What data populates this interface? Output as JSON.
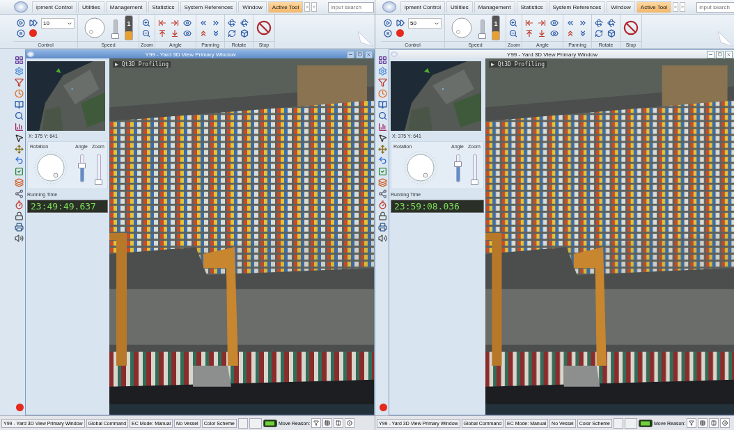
{
  "screens": [
    {
      "menu_tabs": [
        {
          "label": "ipment Control",
          "selected": false
        },
        {
          "label": "Utilities",
          "selected": false
        },
        {
          "label": "Management",
          "selected": false
        },
        {
          "label": "Statistics",
          "selected": false
        },
        {
          "label": "System References",
          "selected": false
        },
        {
          "label": "Window",
          "selected": false
        },
        {
          "label": "Active Tool",
          "selected": true
        }
      ],
      "search": {
        "placeholder": "input search"
      },
      "ribbon_groups": [
        {
          "kind": "control",
          "label": "Control",
          "speed_value": "10"
        },
        {
          "kind": "speed",
          "label": "Speed",
          "speed_slider": {
            "level": 0.0
          },
          "speed_meter": {
            "reading": "1",
            "level": 0.35
          }
        },
        {
          "kind": "zoom",
          "label": "Zoom"
        },
        {
          "kind": "angle",
          "label": "Angle"
        },
        {
          "kind": "panning",
          "label": "Panning"
        },
        {
          "kind": "rotate",
          "label": "Rotate"
        },
        {
          "kind": "stop",
          "label": "Stop"
        }
      ],
      "window": {
        "title": "Y99 - Yard 3D View Primary Window",
        "active": true
      },
      "side_panel": {
        "coordinates": "X: 375 Y: 641",
        "rotation_label": "Rotation",
        "angle": {
          "label": "Angle",
          "level": 0.6
        },
        "zoom": {
          "label": "Zoom",
          "level": 0.0
        },
        "running_time_label": "Running Time",
        "running_time": "23:49:49.637"
      },
      "view": {
        "overlay": "▶ Qt3D Profiling"
      },
      "status_bar": {
        "items": [
          "Y99 - Yard 3D View Primary Window",
          "Global Command",
          "EC Mode: Manual",
          "No Vessel",
          "Color Scheme"
        ],
        "move_reason_label": "Move Reason:"
      }
    },
    {
      "menu_tabs": [
        {
          "label": "ipment Control",
          "selected": false
        },
        {
          "label": "Utilities",
          "selected": false
        },
        {
          "label": "Management",
          "selected": false
        },
        {
          "label": "Statistics",
          "selected": false
        },
        {
          "label": "System References",
          "selected": false
        },
        {
          "label": "Window",
          "selected": false
        },
        {
          "label": "Active Tool",
          "selected": true
        }
      ],
      "search": {
        "placeholder": "input search"
      },
      "ribbon_groups": [
        {
          "kind": "control",
          "label": "Control",
          "speed_value": "50"
        },
        {
          "kind": "speed",
          "label": "Speed",
          "speed_slider": {
            "level": 0.0
          },
          "speed_meter": {
            "reading": "1",
            "level": 0.35
          }
        },
        {
          "kind": "zoom",
          "label": "Zoom"
        },
        {
          "kind": "angle",
          "label": "Angle"
        },
        {
          "kind": "panning",
          "label": "Panning"
        },
        {
          "kind": "rotate",
          "label": "Rotate"
        },
        {
          "kind": "stop",
          "label": "Stop"
        }
      ],
      "window": {
        "title": "Y99 - Yard 3D View Primary Window",
        "active": false
      },
      "side_panel": {
        "coordinates": "X: 375 Y: 641",
        "rotation_label": "Rotation",
        "angle": {
          "label": "Angle",
          "level": 0.65
        },
        "zoom": {
          "label": "Zoom",
          "level": 0.0
        },
        "running_time_label": "Running Time",
        "running_time": "23:59:08.036"
      },
      "view": {
        "overlay": "▶ Qt3D Profiling"
      },
      "status_bar": {
        "items": [
          "Y99 - Yard 3D View Primary Window",
          "Global Command",
          "EC Mode: Manual",
          "No Vessel",
          "Color Scheme"
        ],
        "move_reason_label": "Move Reason:"
      }
    }
  ]
}
